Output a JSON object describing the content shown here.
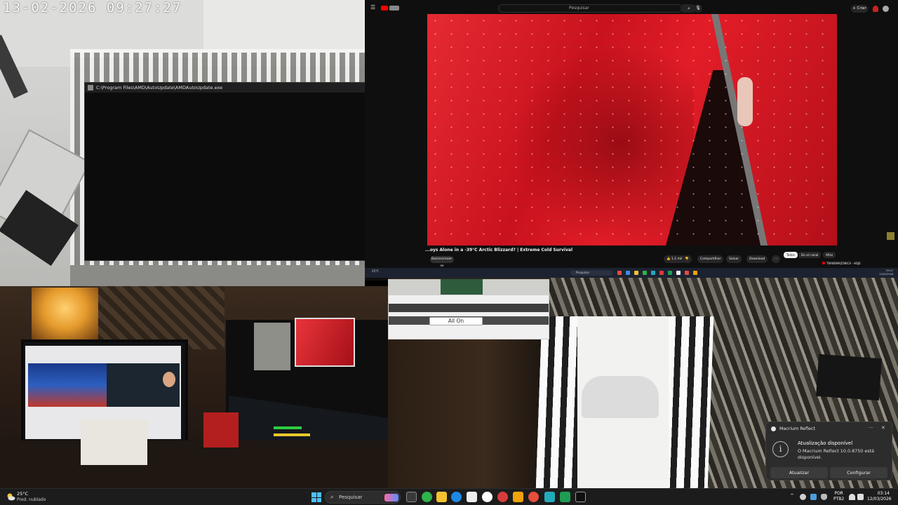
{
  "camera_balcony": {
    "timestamp": "13-02-2026  09:27:27"
  },
  "console_window": {
    "title": "C:\\Program Files\\AMD\\AutoUpdate\\AMDAutoUpdate.exe",
    "minimize_glyph": "—",
    "maximize_glyph": "☐",
    "close_glyph": "✕"
  },
  "youtube": {
    "menu_glyph": "☰",
    "search_placeholder": "Pesquisar",
    "search_glyph": "⌕",
    "mic_glyph": "🎙",
    "create_label": "+ Criar",
    "video_title": "...oys Alone in a -39°C Arctic Blizzard? | Extreme Cold Survival",
    "subscribe_label": "Desinscrever-se",
    "actions": {
      "like": "👍 1,1 mil",
      "dislike": "👎",
      "share": "Compartilhar",
      "save": "Salvar",
      "download": "Download",
      "more": "···"
    },
    "chips": [
      "Todos",
      "Do só canal",
      "Afins"
    ],
    "live_item": "TRANSMAZONICA · HOJE"
  },
  "mini_taskbar": {
    "weather": "25°C",
    "search": "Pesquisar",
    "clock_time": "09:27",
    "clock_date": "13/02/2026"
  },
  "control_panel": {
    "all_on_label": "All On"
  },
  "notification": {
    "app_name": "Macrium Reflect",
    "more_glyph": "···",
    "close_glyph": "✕",
    "info_glyph": "i",
    "heading": "Atualização disponível",
    "body": "O Macrium Reflect 10.0.8750 está disponível.",
    "primary_button": "Atualizar",
    "secondary_button": "Configurar"
  },
  "taskbar": {
    "weather_temp": "25°C",
    "weather_desc": "Pred. nublado",
    "search_placeholder": "Pesquisar",
    "search_glyph": "⌕",
    "tray_chevron": "^",
    "language": "POR",
    "layout": "PTB2",
    "time": "03:14",
    "date": "12/03/2026",
    "app_colors": [
      "#3c8ce7",
      "#f2c230",
      "#2fb34a",
      "#1e88e5",
      "#eeeeee",
      "#ffffff",
      "#d83b3b",
      "#e84d3d",
      "#f0a30a",
      "#34a853",
      "#22aabb",
      "#1f9d55",
      "#eeeeee"
    ]
  },
  "colors": {
    "youtube_red": "#ff0000",
    "windows_accent": "#4cc2ff",
    "toast_bg": "#2c2c2c"
  }
}
